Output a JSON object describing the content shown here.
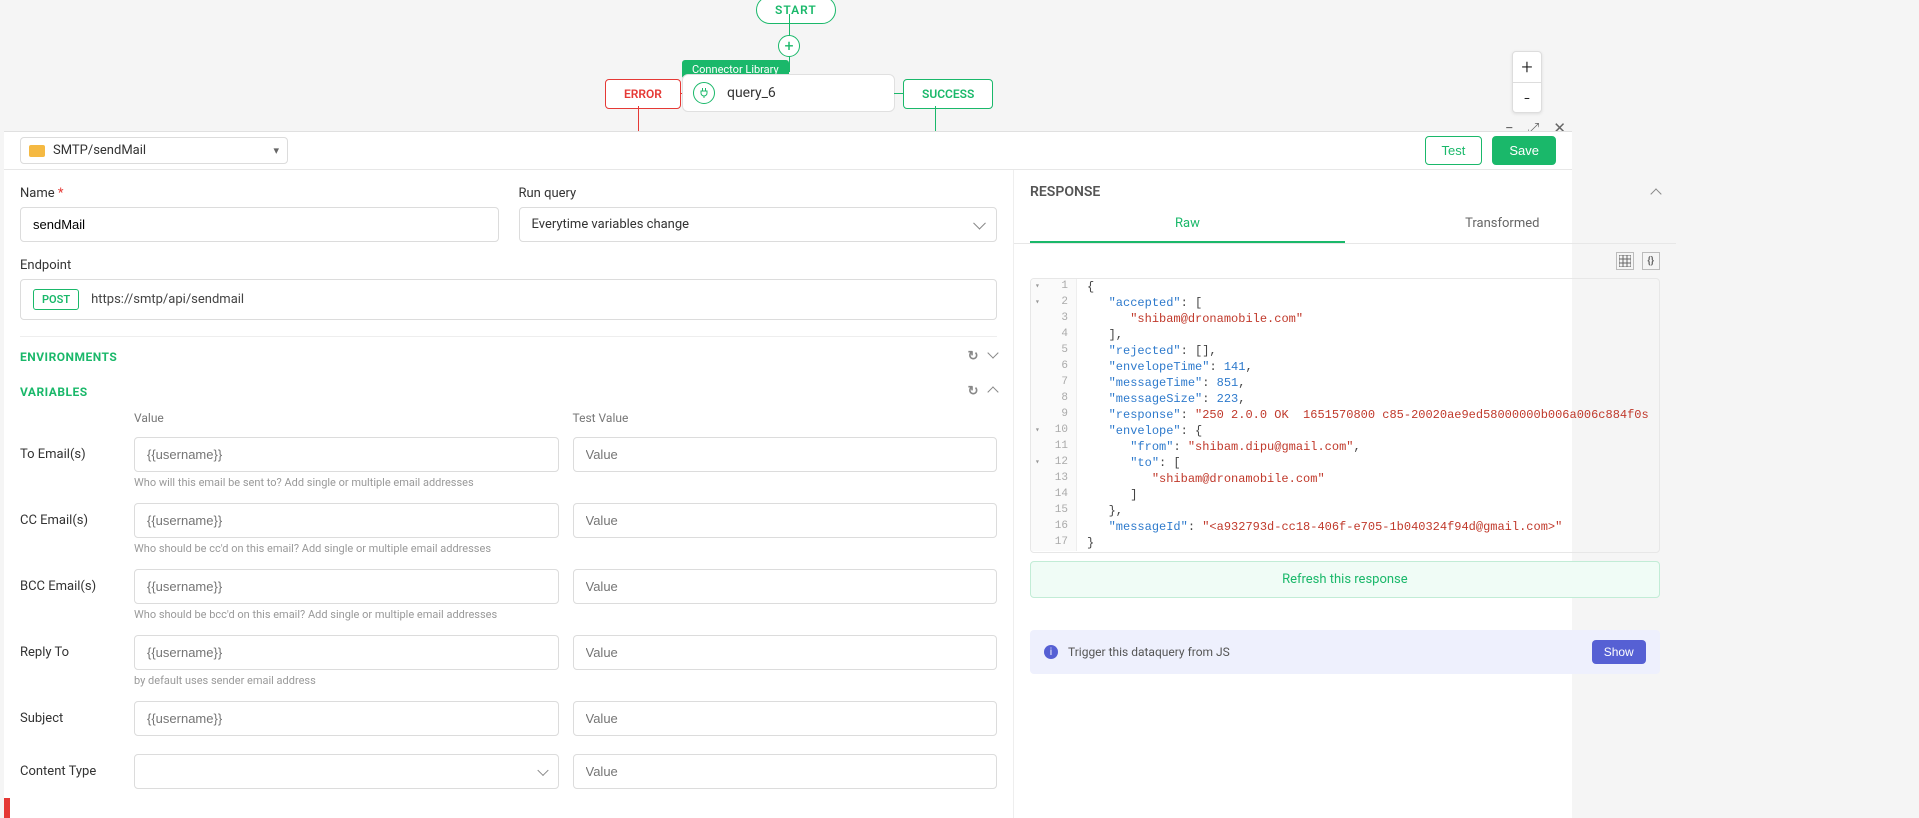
{
  "flow": {
    "start": "START",
    "connectorTag": "Connector Library",
    "queryName": "query_6",
    "error": "ERROR",
    "success": "SUCCESS"
  },
  "toolbar": {
    "selector": "SMTP/sendMail",
    "test": "Test",
    "save": "Save"
  },
  "form": {
    "nameLabel": "Name",
    "nameValue": "sendMail",
    "runQueryLabel": "Run query",
    "runQueryValue": "Everytime variables change",
    "endpointLabel": "Endpoint",
    "method": "POST",
    "endpointUrl": "https://smtp/api/sendmail"
  },
  "sections": {
    "environments": "ENVIRONMENTS",
    "variables": "VARIABLES"
  },
  "varCols": {
    "value": "Value",
    "testValue": "Test Value"
  },
  "vars": {
    "to": {
      "label": "To Email(s)",
      "ph": "{{username}}",
      "tph": "Value",
      "help": "Who will this email be sent to? Add single or multiple email addresses"
    },
    "cc": {
      "label": "CC Email(s)",
      "ph": "{{username}}",
      "tph": "Value",
      "help": "Who should be cc'd on this email? Add single or multiple email addresses"
    },
    "bcc": {
      "label": "BCC Email(s)",
      "ph": "{{username}}",
      "tph": "Value",
      "help": "Who should be bcc'd on this email? Add single or multiple email addresses"
    },
    "replyTo": {
      "label": "Reply To",
      "ph": "{{username}}",
      "tph": "Value",
      "help": "by default uses sender email address"
    },
    "subject": {
      "label": "Subject",
      "ph": "{{username}}",
      "tph": "Value"
    },
    "contentType": {
      "label": "Content Type",
      "ph": "",
      "tph": "Value"
    }
  },
  "response": {
    "header": "RESPONSE",
    "tabRaw": "Raw",
    "tabTransformed": "Transformed",
    "refresh": "Refresh this response",
    "trigger": "Trigger this dataquery from JS",
    "show": "Show"
  },
  "code": {
    "l1": "{",
    "l2a": "\"accepted\"",
    "l2b": ": [",
    "l3": "\"shibam@dronamobile.com\"",
    "l4": "],",
    "l5a": "\"rejected\"",
    "l5b": ": [],",
    "l6a": "\"envelopeTime\"",
    "l6b": ": ",
    "l6c": "141",
    "l6d": ",",
    "l7a": "\"messageTime\"",
    "l7b": ": ",
    "l7c": "851",
    "l7d": ",",
    "l8a": "\"messageSize\"",
    "l8b": ": ",
    "l8c": "223",
    "l8d": ",",
    "l9a": "\"response\"",
    "l9b": ": ",
    "l9c": "\"250 2.0.0 OK  1651570800 c85-20020ae9ed58000000b006a006c884f0s",
    "l10a": "\"envelope\"",
    "l10b": ": {",
    "l11a": "\"from\"",
    "l11b": ": ",
    "l11c": "\"shibam.dipu@gmail.com\"",
    "l11d": ",",
    "l12a": "\"to\"",
    "l12b": ": [",
    "l13": "\"shibam@dronamobile.com\"",
    "l14": "]",
    "l15": "},",
    "l16a": "\"messageId\"",
    "l16b": ": ",
    "l16c": "\"<a932793d-cc18-406f-e705-1b040324f94d@gmail.com>\"",
    "l17": "}"
  }
}
